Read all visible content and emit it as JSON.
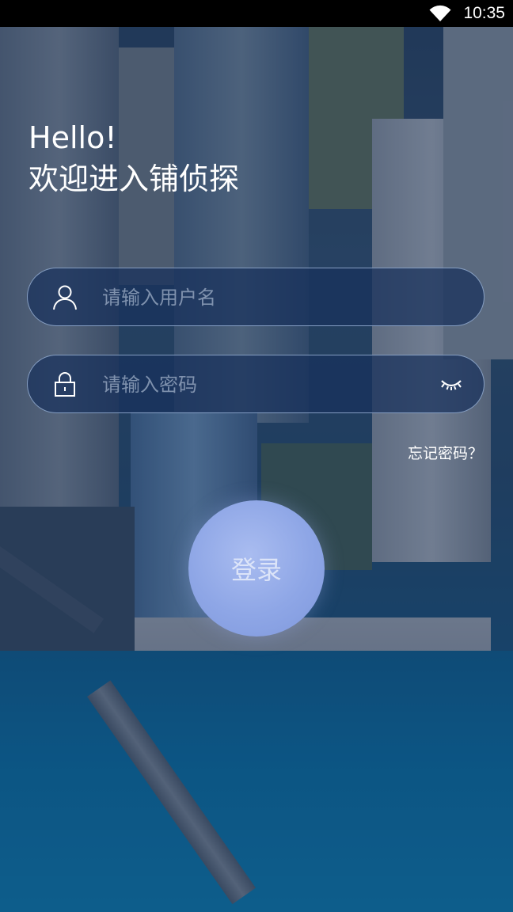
{
  "status_bar": {
    "time": "10:35",
    "wifi_icon": "wifi-icon"
  },
  "greeting": {
    "line1": "Hello!",
    "line2": "欢迎进入铺侦探"
  },
  "username": {
    "placeholder": "请输入用户名",
    "value": "",
    "icon": "user-icon"
  },
  "password": {
    "placeholder": "请输入密码",
    "value": "",
    "icon": "lock-icon",
    "toggle_icon": "eye-closed-icon"
  },
  "forgot_password": "忘记密码？",
  "login_button": "登录"
}
